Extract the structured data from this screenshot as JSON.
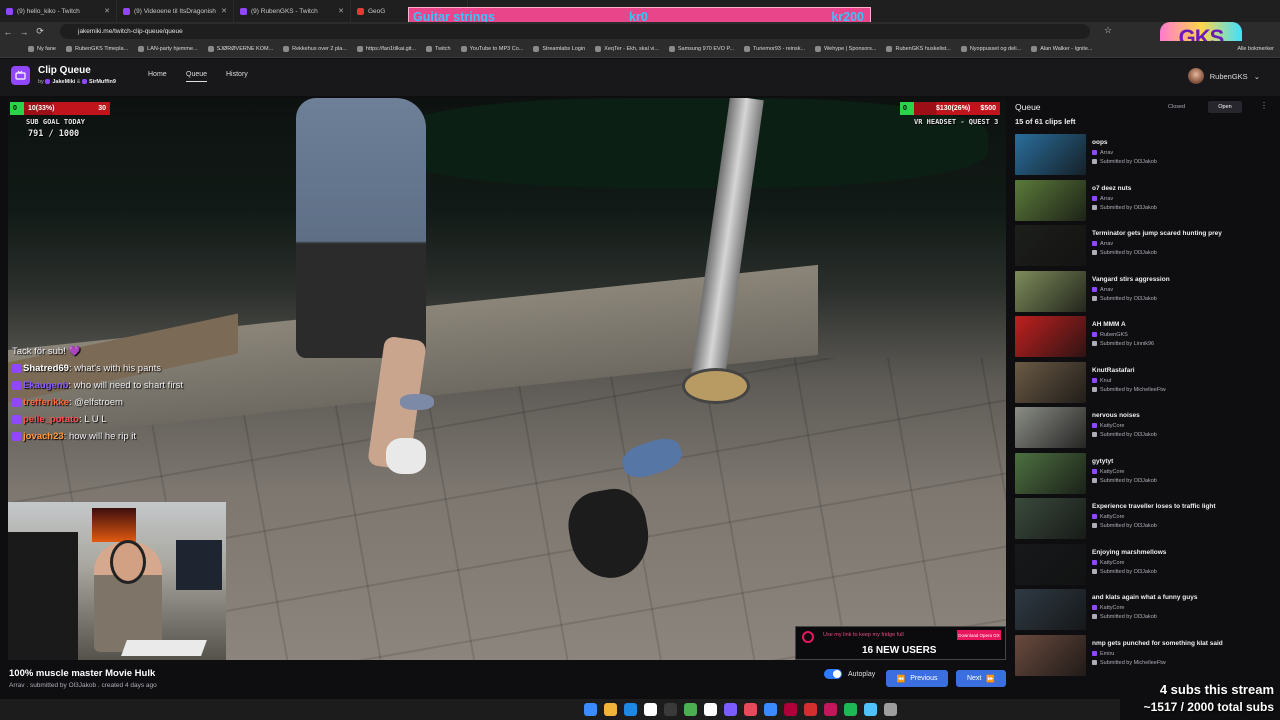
{
  "browser": {
    "tabs": [
      {
        "label": "(9) hello_kiko - Twitch"
      },
      {
        "label": "(9) Videoene til ItsDragonish"
      },
      {
        "label": "(9) RubenGKS - Twitch"
      },
      {
        "label": "GeoG"
      }
    ],
    "url": "jakemiki.me/twitch-clip-queue/queue",
    "bookmarks": [
      "Ny fane",
      "RubenGKS Timepla...",
      "LAN-party hjemme...",
      "SJØRØVERNE KOM...",
      "Rekkehus over 2 pla...",
      "https://fan1tilkai.git...",
      "Twitch",
      "YouTube to MP3 Co...",
      "Streamlabs Login",
      "XeqTer - Ekh, skal vi...",
      "Samsung 970 EVO P...",
      "Turiemor93 - reinsk...",
      "Wehype | Sponsors...",
      "RubenGKS huskelist...",
      "Nyoppusset og deli...",
      "Alan Walker - Ignite..."
    ],
    "bookmarks_end": "Alle bokmerker"
  },
  "banner": {
    "label": "Guitar strings",
    "current": "kr0",
    "goal": "kr200"
  },
  "logo_overlay": "GKS",
  "app": {
    "title": "Clip Queue",
    "by_prefix": "by",
    "author1": "JakeMiki",
    "author2": "SirMuffin9",
    "nav": {
      "home": "Home",
      "queue": "Queue",
      "history": "History"
    },
    "user": "RubenGKS"
  },
  "overlay": {
    "left_goal": {
      "start": "0",
      "progress": "10(33%)",
      "target": "30",
      "progress_fraction": 0.33
    },
    "sub_goal_title": "SUB GOAL TODAY",
    "sub_goal_value": "791 / 1000",
    "right_goal": {
      "start": "0",
      "progress": "$130(26%)",
      "target": "$500",
      "progress_fraction": 0.26
    },
    "right_goal_title": "VR HEADSET - QUEST 3"
  },
  "chat": [
    {
      "user": "",
      "text": "Tack för sub! 💜",
      "color": "#ffffff"
    },
    {
      "user": "Shatred69",
      "text": ": what's with his pants",
      "color": "#ffffff"
    },
    {
      "user": "Ekaugenb",
      "text": ": who will need to shart first",
      "color": "#8a5cff"
    },
    {
      "user": "trefferikke",
      "text": ": @elfstroem",
      "color": "#ff6a3d"
    },
    {
      "user": "pelle_potato",
      "text": ": L U L",
      "color": "#ff4d4d"
    },
    {
      "user": "jovach23",
      "text": ": how will he rip it",
      "color": "#ff9a3d"
    }
  ],
  "sponsor": {
    "line1": "Use my link to keep my fridge full",
    "line2": "16 NEW USERS",
    "button": "Download Opera GX"
  },
  "clip": {
    "title": "100% muscle master Movie Hulk",
    "meta": "Arrav . submitted by Ol3Jakob . created 4 days ago"
  },
  "controls": {
    "autoplay": "Autoplay",
    "previous": "Previous",
    "next": "Next"
  },
  "queue": {
    "title": "Queue",
    "count": "15 of 61 clips left",
    "closed": "Closed",
    "open": "Open",
    "items": [
      {
        "title": "oops",
        "channel": "Arrav",
        "submitted": "Submitted by Ol3Jakob",
        "thumb": "#2a6e9c"
      },
      {
        "title": "o7 deez nuts",
        "channel": "Arrav",
        "submitted": "Submitted by Ol3Jakob",
        "thumb": "#5b7a3a"
      },
      {
        "title": "Terminator gets jump scared hunting prey",
        "channel": "Arrav",
        "submitted": "Submitted by Ol3Jakob",
        "thumb": "#1d1f1b"
      },
      {
        "title": "Vangard stirs aggression",
        "channel": "Arrav",
        "submitted": "Submitted by Ol3Jakob",
        "thumb": "#7d8c5a"
      },
      {
        "title": "AH MMM A",
        "channel": "RubenGKS",
        "submitted": "Submitted by Linnik96",
        "thumb": "#c0201f"
      },
      {
        "title": "KnutRastafari",
        "channel": "Knut",
        "submitted": "Submitted by MichelleeFtw",
        "thumb": "#6b5a45"
      },
      {
        "title": "nervous noises",
        "channel": "KattyCore",
        "submitted": "Submitted by Ol3Jakob",
        "thumb": "#8b8d86"
      },
      {
        "title": "gytytyt",
        "channel": "KattyCore",
        "submitted": "Submitted by Ol3Jakob",
        "thumb": "#4d7040"
      },
      {
        "title": "Experience traveller loses to traffic light",
        "channel": "KattyCore",
        "submitted": "Submitted by Ol3Jakob",
        "thumb": "#3a4a3c"
      },
      {
        "title": "Enjoying marshmellows",
        "channel": "KattyCore",
        "submitted": "Submitted by Ol3Jakob",
        "thumb": "#16181a"
      },
      {
        "title": "and klats again what a funny guys",
        "channel": "KattyCore",
        "submitted": "Submitted by Ol3Jakob",
        "thumb": "#2f3a44"
      },
      {
        "title": "nmp gets punched for something klat said",
        "channel": "Emiru",
        "submitted": "Submitted by MichelleeFtw",
        "thumb": "#6a4a3e"
      }
    ]
  },
  "stream_overlay": {
    "subs_stream": "4 subs this stream",
    "total_subs": "~1517 / 2000 total subs"
  },
  "taskbar_colors": [
    "#3b8bff",
    "#f2b53a",
    "#1e88e5",
    "#ffffff",
    "#3a3a3a",
    "#4caf50",
    "#ffffff",
    "#7a5cff",
    "#e74a5a",
    "#3b8bff",
    "#b0003a",
    "#d32f2f",
    "#c2185b",
    "#1db954",
    "#4fc3f7",
    "#9e9e9e"
  ]
}
